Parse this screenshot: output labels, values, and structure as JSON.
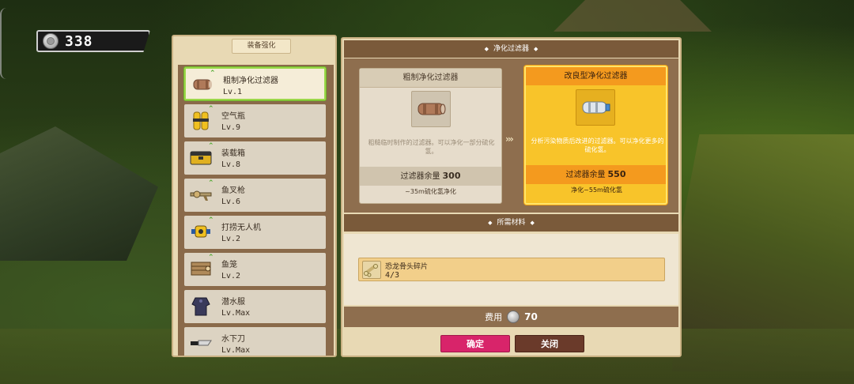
{
  "currency": {
    "amount": "338",
    "icon": "silver-coin-icon"
  },
  "left_panel": {
    "title": "装备强化",
    "items": [
      {
        "name": "粗制净化过滤器",
        "level": "Lv.1",
        "icon": "filter-icon",
        "upgradable": true,
        "selected": true
      },
      {
        "name": "空气瓶",
        "level": "Lv.9",
        "icon": "air-tank-icon",
        "upgradable": true,
        "selected": false
      },
      {
        "name": "装载箱",
        "level": "Lv.8",
        "icon": "cargo-box-icon",
        "upgradable": true,
        "selected": false
      },
      {
        "name": "鱼叉枪",
        "level": "Lv.6",
        "icon": "harpoon-gun-icon",
        "upgradable": true,
        "selected": false
      },
      {
        "name": "打捞无人机",
        "level": "Lv.2",
        "icon": "salvage-drone-icon",
        "upgradable": true,
        "selected": false
      },
      {
        "name": "鱼笼",
        "level": "Lv.2",
        "icon": "fish-trap-icon",
        "upgradable": true,
        "selected": false
      },
      {
        "name": "潜水服",
        "level": "Lv.Max",
        "icon": "diving-suit-icon",
        "upgradable": false,
        "selected": false
      },
      {
        "name": "水下刀",
        "level": "Lv.Max",
        "icon": "underwater-knife-icon",
        "upgradable": false,
        "selected": false
      }
    ]
  },
  "right_panel": {
    "header": "净化过滤器",
    "current": {
      "title": "粗制净化过滤器",
      "description": "粗糙临时制作的过滤器。可以净化一部分硫化氢。",
      "remaining_label": "过滤器余量",
      "remaining_value": "300",
      "footer": "~35m硫化氢净化"
    },
    "arrows": "›››",
    "upgraded": {
      "title": "改良型净化过滤器",
      "description": "分析污染物质后改进的过滤器。可以净化更多的硫化氢。",
      "remaining_label": "过滤器余量",
      "remaining_value": "550",
      "footer": "净化~55m硫化氢"
    },
    "materials_header": "所需材料",
    "materials": [
      {
        "name": "恐龙骨头碎片",
        "count": "4/3",
        "icon": "dino-bone-fragment-icon"
      }
    ],
    "cost_label": "费用",
    "cost_value": "70",
    "confirm_label": "确定",
    "close_label": "关闭"
  },
  "colors": {
    "confirm": "#d8246a",
    "close": "#6a3a2a",
    "highlight": "#f8c42a",
    "selected_border": "#9cd84a"
  }
}
